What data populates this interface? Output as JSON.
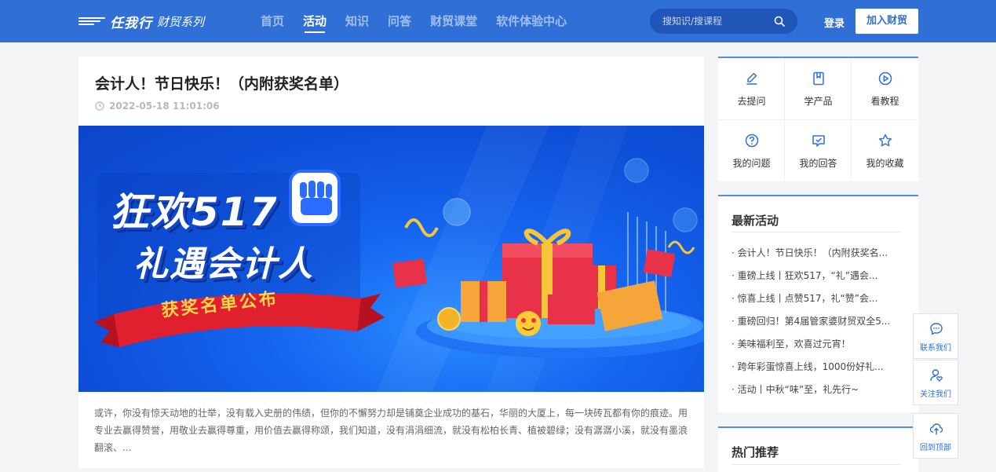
{
  "header": {
    "logo_brand": "任我行",
    "logo_sub": "财贸系列",
    "nav": [
      {
        "label": "首页",
        "active": false
      },
      {
        "label": "活动",
        "active": true
      },
      {
        "label": "知识",
        "active": false
      },
      {
        "label": "问答",
        "active": false
      },
      {
        "label": "财贸课堂",
        "active": false
      },
      {
        "label": "软件体验中心",
        "active": false
      }
    ],
    "search_placeholder": "搜知识/搜课程",
    "search_icon": "search-icon",
    "login_label": "登录",
    "join_label": "加入财贸"
  },
  "article": {
    "title": "会计人！节日快乐！（内附获奖名单）",
    "time": "2022-05-18 11:01:06",
    "banner": {
      "line1": "狂欢517",
      "line2": "礼遇会计人",
      "ribbon": "获奖名单公布"
    },
    "excerpt": "或许，你没有惊天动地的壮举，没有载入史册的伟绩，但你的不懈努力却是铺奠企业成功的基石，华丽的大厦上，每一块砖瓦都有你的痕迹。用专业去赢得赞誉，用敬业去赢得尊重，用价值去赢得称颂，我们知道，没有涓涓细流，就没有松柏长青、植被碧绿；没有潺潺小溪，就没有墨浪翻滚、..."
  },
  "quick_panel": {
    "items": [
      {
        "label": "去提问",
        "icon": "pencil-icon"
      },
      {
        "label": "学产品",
        "icon": "book-icon"
      },
      {
        "label": "看教程",
        "icon": "play-icon"
      },
      {
        "label": "我的问题",
        "icon": "question-icon"
      },
      {
        "label": "我的回答",
        "icon": "answer-icon"
      },
      {
        "label": "我的收藏",
        "icon": "star-icon"
      }
    ]
  },
  "latest": {
    "title": "最新活动",
    "items": [
      "· 会计人！节日快乐！（内附获奖名...",
      "· 重磅上线丨狂欢517，“礼”遇会...",
      "· 惊喜上线丨点赞517，礼“赞”会...",
      "· 重磅回归！第4届管家婆财贸双全5...",
      "· 美味福利至，欢喜过元宵！",
      "· 跨年彩蛋惊喜上线，1000份好礼...",
      "· 活动丨中秋“味”至，礼先行~"
    ]
  },
  "hot": {
    "title": "热门推荐"
  },
  "float": {
    "contact": "联系我们",
    "follow": "关注我们",
    "top": "回到顶部"
  },
  "colors": {
    "brand": "#2f6fd6",
    "accent_border": "#4f8ee8"
  }
}
